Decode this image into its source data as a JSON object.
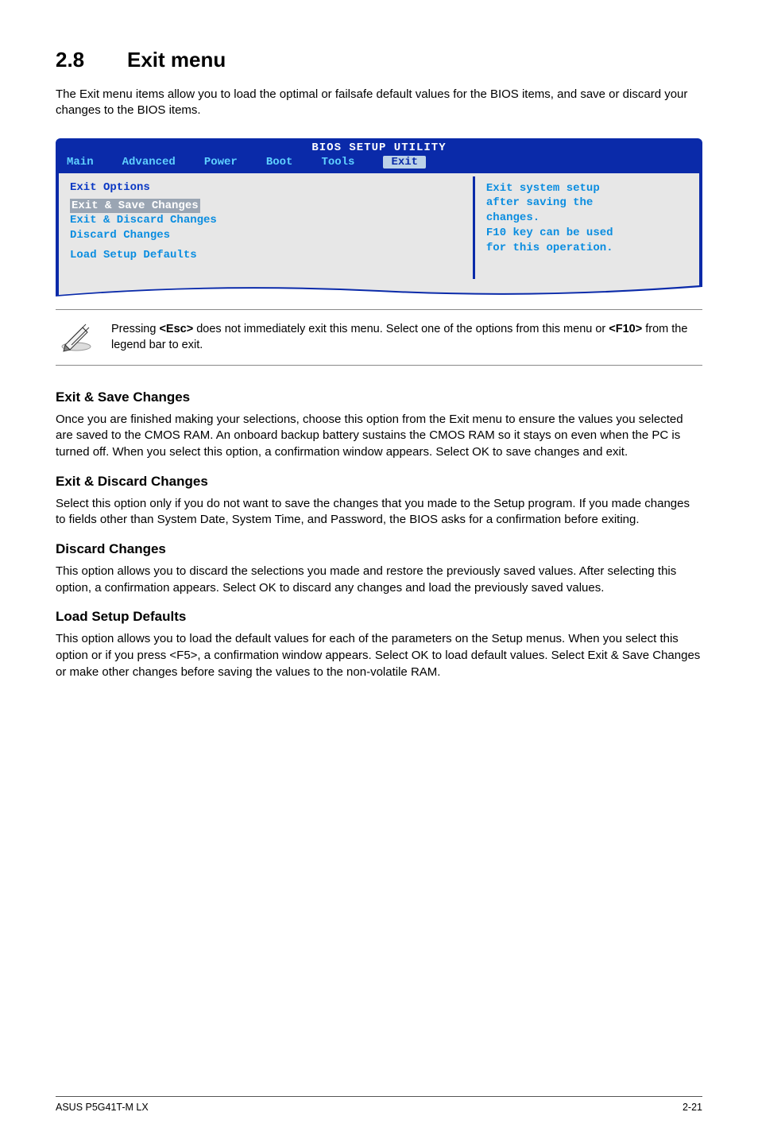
{
  "heading": {
    "num": "2.8",
    "title": "Exit menu"
  },
  "intro": "The Exit menu items allow you to load the optimal or failsafe default values for the BIOS items, and save or discard your changes to the BIOS items.",
  "bios": {
    "title": "BIOS SETUP UTILITY",
    "tabs": [
      "Main",
      "Advanced",
      "Power",
      "Boot",
      "Tools",
      "Exit"
    ],
    "active_tab": "Exit",
    "left_title": "Exit Options",
    "lines": [
      {
        "label": "Exit & Save Changes",
        "selected": true
      },
      {
        "label": "Exit & Discard Changes",
        "selected": false
      },
      {
        "label": "Discard Changes",
        "selected": false
      },
      {
        "label": "Load Setup Defaults",
        "selected": false
      }
    ],
    "help": [
      "Exit system setup",
      "after saving the",
      "changes.",
      "",
      "F10 key can be used",
      "for this operation."
    ]
  },
  "note": {
    "text_before": "Pressing ",
    "key1": "<Esc>",
    "text_mid": " does not immediately exit this menu. Select one of the options from this menu or ",
    "key2": "<F10>",
    "text_after": " from the legend bar to exit."
  },
  "sections": [
    {
      "title": "Exit & Save Changes",
      "body": "Once you are finished making your selections, choose this option from the Exit menu to ensure the values you selected are saved to the CMOS RAM. An onboard backup battery sustains the CMOS RAM so it stays on even when the PC is turned off. When you select this option, a confirmation window appears. Select OK to save changes and exit."
    },
    {
      "title": "Exit & Discard Changes",
      "body": "Select this option only if you do not want to save the changes that you made to the Setup program. If you made changes to fields other than System Date, System Time, and Password, the BIOS asks for a confirmation before exiting."
    },
    {
      "title": "Discard Changes",
      "body": "This option allows you to discard the selections you made and restore the previously saved values. After selecting this option, a confirmation appears. Select OK to discard any changes and load the previously saved values."
    },
    {
      "title": "Load Setup Defaults",
      "body": "This option allows you to load the default values for each of the parameters on the Setup menus. When you select this option or if you press <F5>, a confirmation window appears. Select OK to load default values. Select Exit & Save Changes or make other changes before saving the values to the non-volatile RAM."
    }
  ],
  "footer": {
    "left": "ASUS P5G41T-M LX",
    "right": "2-21"
  }
}
